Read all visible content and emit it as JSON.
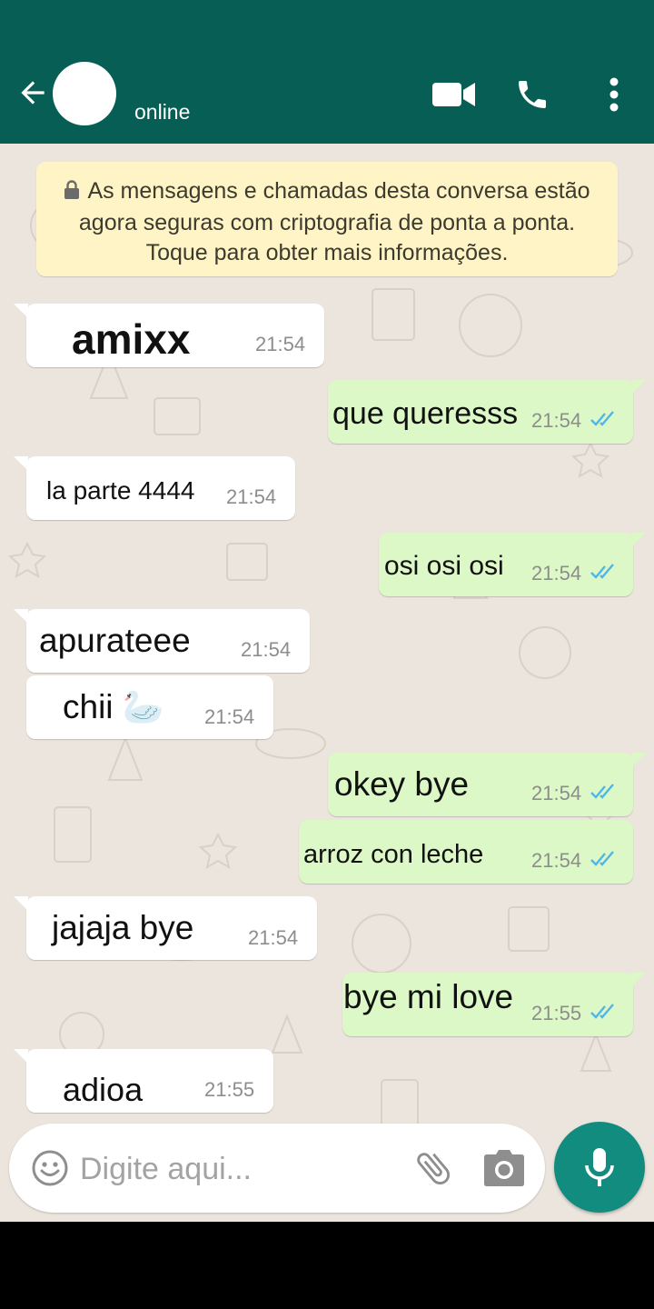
{
  "header": {
    "status": "online",
    "colors": {
      "bar": "#075E54",
      "accent": "#128C7E"
    }
  },
  "encryption_notice": "As mensagens e chamadas desta conversa estão agora seguras com criptografia de ponta a ponta. Toque para obter mais informações.",
  "messages": [
    {
      "direction": "in",
      "text": "amixx",
      "time": "21:54"
    },
    {
      "direction": "out",
      "text": "que queresss",
      "time": "21:54",
      "read": true
    },
    {
      "direction": "in",
      "text": "la parte 4444",
      "time": "21:54"
    },
    {
      "direction": "out",
      "text": "osi osi osi",
      "time": "21:54",
      "read": true
    },
    {
      "direction": "in",
      "text": "apurateee",
      "time": "21:54"
    },
    {
      "direction": "in",
      "text": "chii 🦢",
      "time": "21:54"
    },
    {
      "direction": "out",
      "text": "okey bye",
      "time": "21:54",
      "read": true
    },
    {
      "direction": "out",
      "text": "arroz con leche",
      "time": "21:54",
      "read": true
    },
    {
      "direction": "in",
      "text": "jajaja bye",
      "time": "21:54"
    },
    {
      "direction": "out",
      "text": "bye mi love",
      "time": "21:55",
      "read": true
    },
    {
      "direction": "in",
      "text": "adioa",
      "time": "21:55"
    }
  ],
  "composer": {
    "placeholder": "Digite aqui..."
  },
  "icons": {
    "back": "arrow-left-icon",
    "video": "video-camera-icon",
    "call": "phone-icon",
    "menu": "more-vertical-icon",
    "lock": "lock-icon",
    "emoji": "emoji-icon",
    "attach": "paperclip-icon",
    "camera": "camera-icon",
    "mic": "microphone-icon",
    "read": "double-check-icon"
  }
}
